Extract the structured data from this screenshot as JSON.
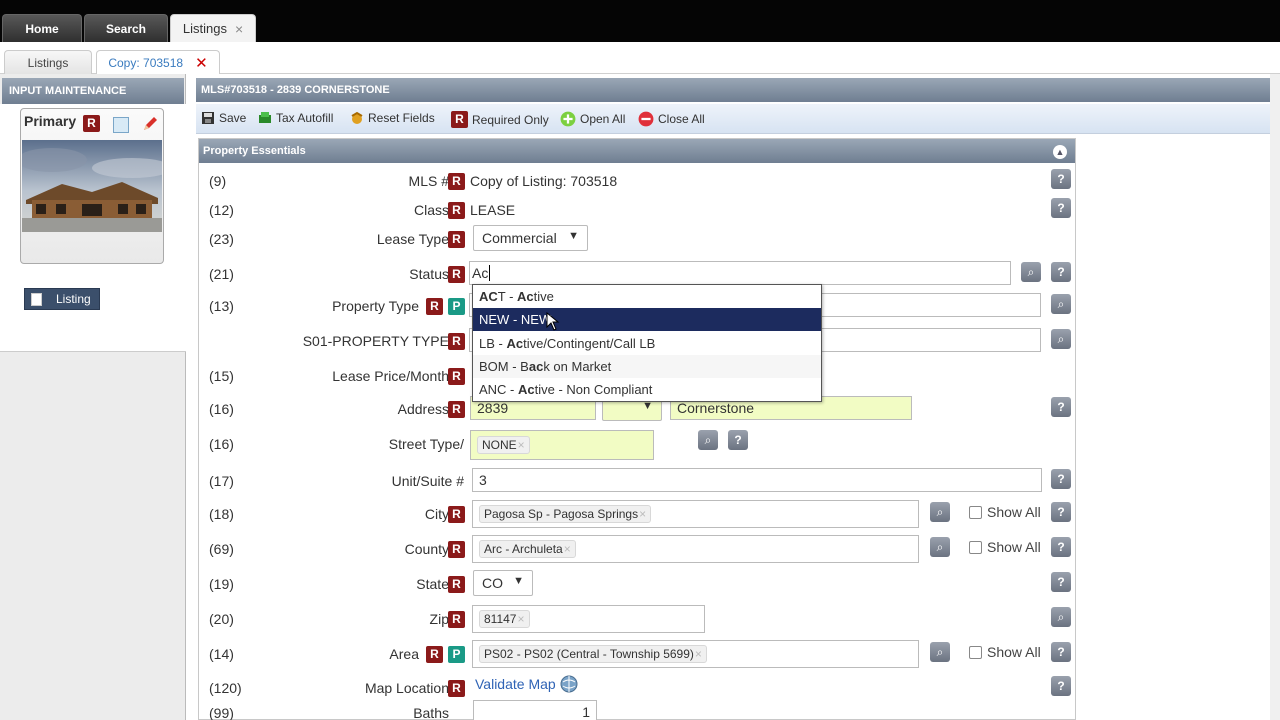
{
  "topnav": {
    "tabs": [
      {
        "label": "Home"
      },
      {
        "label": "Search"
      },
      {
        "label": "Listings",
        "close": "×"
      }
    ]
  },
  "subnav": {
    "tabs": [
      {
        "label": "Listings"
      },
      {
        "label": "Copy: 703518",
        "close": "✕"
      }
    ]
  },
  "left": {
    "title": "INPUT MAINTENANCE",
    "primary_label": "Primary",
    "r_badge": "R",
    "listing_btn": "Listing"
  },
  "main": {
    "title": "MLS#703518 - 2839 CORNERSTONE",
    "toolbar": {
      "save": "Save",
      "tax_autofill": "Tax Autofill",
      "reset_fields": "Reset Fields",
      "required_only": "Required Only",
      "open_all": "Open All",
      "close_all": "Close All"
    },
    "section_title": "Property Essentials",
    "fields": {
      "mls": {
        "num": "(9)",
        "label": "MLS #",
        "value": "Copy of Listing: 703518"
      },
      "class": {
        "num": "(12)",
        "label": "Class",
        "value": "LEASE"
      },
      "lease_type": {
        "num": "(23)",
        "label": "Lease Type",
        "value": "Commercial"
      },
      "status": {
        "num": "(21)",
        "label": "Status",
        "value": "Ac"
      },
      "property_type": {
        "num": "(13)",
        "label": "Property Type"
      },
      "s01_property_type": {
        "num": "",
        "label": "S01-PROPERTY TYPE"
      },
      "lease_price": {
        "num": "(15)",
        "label": "Lease Price/Month"
      },
      "address": {
        "num": "(16)",
        "label": "Address",
        "number": "2839",
        "street": "Cornerstone"
      },
      "street_type": {
        "num": "(16)",
        "label": "Street Type/",
        "tag": "NONE"
      },
      "unit": {
        "num": "(17)",
        "label": "Unit/Suite #",
        "value": "3"
      },
      "city": {
        "num": "(18)",
        "label": "City",
        "tag": "Pagosa Sp - Pagosa Springs",
        "show_all": "Show All"
      },
      "county": {
        "num": "(69)",
        "label": "County",
        "tag": "Arc - Archuleta",
        "show_all": "Show All"
      },
      "state": {
        "num": "(19)",
        "label": "State",
        "value": "CO"
      },
      "zip": {
        "num": "(20)",
        "label": "Zip",
        "tag": "81147"
      },
      "area": {
        "num": "(14)",
        "label": "Area",
        "tag": "PS02 - PS02 (Central - Township 5699)",
        "show_all": "Show All"
      },
      "map_location": {
        "num": "(120)",
        "label": "Map Location",
        "link": "Validate Map"
      },
      "baths": {
        "num": "(99)",
        "label": "Baths",
        "value": "1"
      }
    },
    "status_dropdown": [
      {
        "b1": "A",
        "b2": "C",
        "rest": "T - ",
        "b3": "Ac",
        "tail": "tive"
      },
      {
        "plain": "NEW - NEW"
      },
      {
        "pre": "LB - ",
        "b": "Ac",
        "tail": "tive/Contingent/Call LB"
      },
      {
        "pre": "BOM - B",
        "b": "ac",
        "tail": "k on Market"
      },
      {
        "pre": "ANC - ",
        "b": "Ac",
        "tail": "tive - Non Compliant"
      }
    ],
    "badges": {
      "r": "R",
      "p": "P",
      "help": "?"
    }
  }
}
